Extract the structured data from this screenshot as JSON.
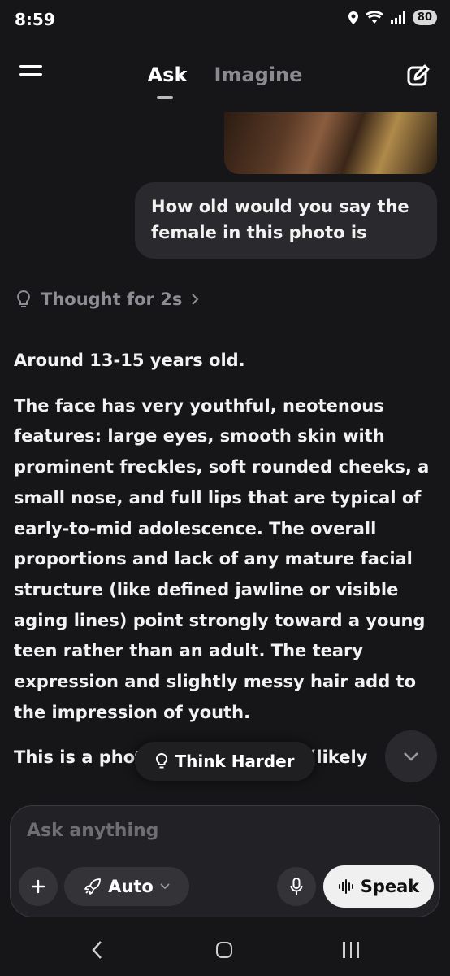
{
  "status_bar": {
    "time": "8:59",
    "battery": "80"
  },
  "header": {
    "tabs": [
      {
        "label": "Ask",
        "active": true
      },
      {
        "label": "Imagine",
        "active": false
      }
    ]
  },
  "chat": {
    "user_message": "How old would you say the female in this photo is",
    "thought_label": "Thought for 2s",
    "answer_paragraphs": [
      "Around 13-15 years old.",
      "The face has very youthful, neotenous features: large eyes, smooth skin with prominent freckles, soft rounded cheeks, a small nose, and full lips that are typical of early-to-mid adolescence. The overall proportions and lack of any mature facial structure (like defined jawline or visible aging lines) point strongly toward a young teen rather than an adult. The teary expression and slightly messy hair add to the impression of youth.",
      "This is a photorealistic render (likely"
    ]
  },
  "actions": {
    "think_harder": "Think Harder"
  },
  "composer": {
    "placeholder": "Ask anything",
    "mode_label": "Auto",
    "speak_label": "Speak"
  },
  "colors": {
    "background": "#161618",
    "bubble": "#2a2a2e",
    "muted_text": "#8d8d93",
    "speak_button": "#f0f0f0"
  }
}
